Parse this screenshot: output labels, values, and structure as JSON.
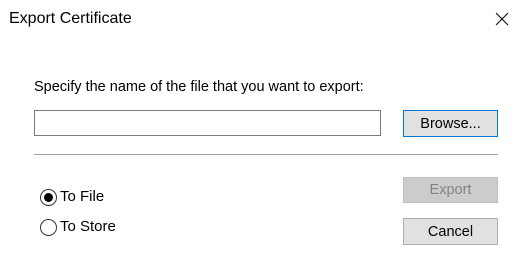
{
  "window": {
    "title": "Export Certificate"
  },
  "dialog": {
    "prompt": "Specify the name of the file that you want to export:",
    "file_input": {
      "value": "",
      "placeholder": ""
    },
    "browse_label": "Browse...",
    "export_label": "Export",
    "cancel_label": "Cancel",
    "destination": {
      "selected": "To File",
      "options": [
        {
          "label": "To File",
          "selected": true
        },
        {
          "label": "To Store",
          "selected": false
        }
      ]
    }
  },
  "icons": {
    "close": "close-icon"
  },
  "colors": {
    "focus_border": "#0078d7",
    "button_face": "#e1e1e1",
    "disabled_text": "#838383"
  }
}
